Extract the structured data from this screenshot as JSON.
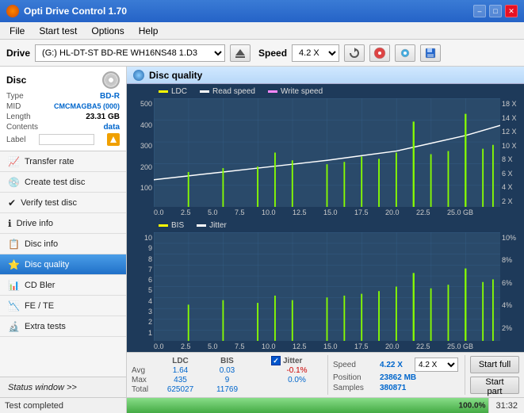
{
  "titleBar": {
    "title": "Opti Drive Control 1.70",
    "minimize": "–",
    "maximize": "□",
    "close": "✕"
  },
  "menuBar": {
    "items": [
      "File",
      "Start test",
      "Options",
      "Help"
    ]
  },
  "toolbar": {
    "driveLabel": "Drive",
    "driveValue": "(G:)  HL-DT-ST BD-RE  WH16NS48 1.D3",
    "speedLabel": "Speed",
    "speedValue": "4.2 X"
  },
  "discInfo": {
    "sectionLabel": "Disc",
    "typeLabel": "Type",
    "typeValue": "BD-R",
    "midLabel": "MID",
    "midValue": "CMCMAGBA5 (000)",
    "lengthLabel": "Length",
    "lengthValue": "23.31 GB",
    "contentsLabel": "Contents",
    "contentsValue": "data",
    "labelLabel": "Label",
    "labelValue": ""
  },
  "navButtons": [
    {
      "id": "transfer-rate",
      "label": "Transfer rate",
      "icon": "📈"
    },
    {
      "id": "create-test-disc",
      "label": "Create test disc",
      "icon": "💿"
    },
    {
      "id": "verify-test-disc",
      "label": "Verify test disc",
      "icon": "✔"
    },
    {
      "id": "drive-info",
      "label": "Drive info",
      "icon": "ℹ"
    },
    {
      "id": "disc-info",
      "label": "Disc info",
      "icon": "📋"
    },
    {
      "id": "disc-quality",
      "label": "Disc quality",
      "icon": "⭐",
      "active": true
    },
    {
      "id": "cd-bler",
      "label": "CD Bler",
      "icon": "📊"
    },
    {
      "id": "fe-te",
      "label": "FE / TE",
      "icon": "📉"
    },
    {
      "id": "extra-tests",
      "label": "Extra tests",
      "icon": "🔬"
    }
  ],
  "statusWindow": "Status window >>",
  "chartPanel": {
    "title": "Disc quality"
  },
  "legend": {
    "ldc": {
      "label": "LDC",
      "color": "#ffff00"
    },
    "readSpeed": {
      "label": "Read speed",
      "color": "#ffffff"
    },
    "writeSpeed": {
      "label": "Write speed",
      "color": "#ff88ff"
    },
    "bis": {
      "label": "BIS",
      "color": "#ffff00"
    },
    "jitter": {
      "label": "Jitter",
      "color": "#ffffff"
    }
  },
  "stats": {
    "headers": [
      "",
      "LDC",
      "BIS",
      "",
      "Jitter",
      "Speed",
      ""
    ],
    "avgLabel": "Avg",
    "avgLdc": "1.64",
    "avgBis": "0.03",
    "avgJitter": "-0.1%",
    "maxLabel": "Max",
    "maxLdc": "435",
    "maxBis": "9",
    "maxJitter": "0.0%",
    "totalLabel": "Total",
    "totalLdc": "625027",
    "totalBis": "11769",
    "speedLabel": "Speed",
    "speedValue": "4.22 X",
    "speedSelect": "4.2 X",
    "positionLabel": "Position",
    "positionValue": "23862 MB",
    "samplesLabel": "Samples",
    "samplesValue": "380871",
    "startFullLabel": "Start full",
    "startPartLabel": "Start part",
    "jitterChecked": true,
    "jitterLabel": "Jitter"
  },
  "statusBar": {
    "text": "Test completed",
    "progress": 100.0,
    "progressText": "100.0%",
    "time": "31:32"
  },
  "xAxisLabels": [
    "0.0",
    "2.5",
    "5.0",
    "7.5",
    "10.0",
    "12.5",
    "15.0",
    "17.5",
    "20.0",
    "22.5",
    "25.0"
  ],
  "topChartYLabels": [
    "500",
    "400",
    "300",
    "200",
    "100"
  ],
  "topChartYRight": [
    "18 X",
    "14 X",
    "12 X",
    "10 X",
    "8 X",
    "6 X",
    "4 X",
    "2 X"
  ],
  "bottomChartYLabels": [
    "10",
    "9",
    "8",
    "7",
    "6",
    "5",
    "4",
    "3",
    "2",
    "1"
  ],
  "bottomChartYRight": [
    "10%",
    "8%",
    "6%",
    "4%",
    "2%"
  ]
}
